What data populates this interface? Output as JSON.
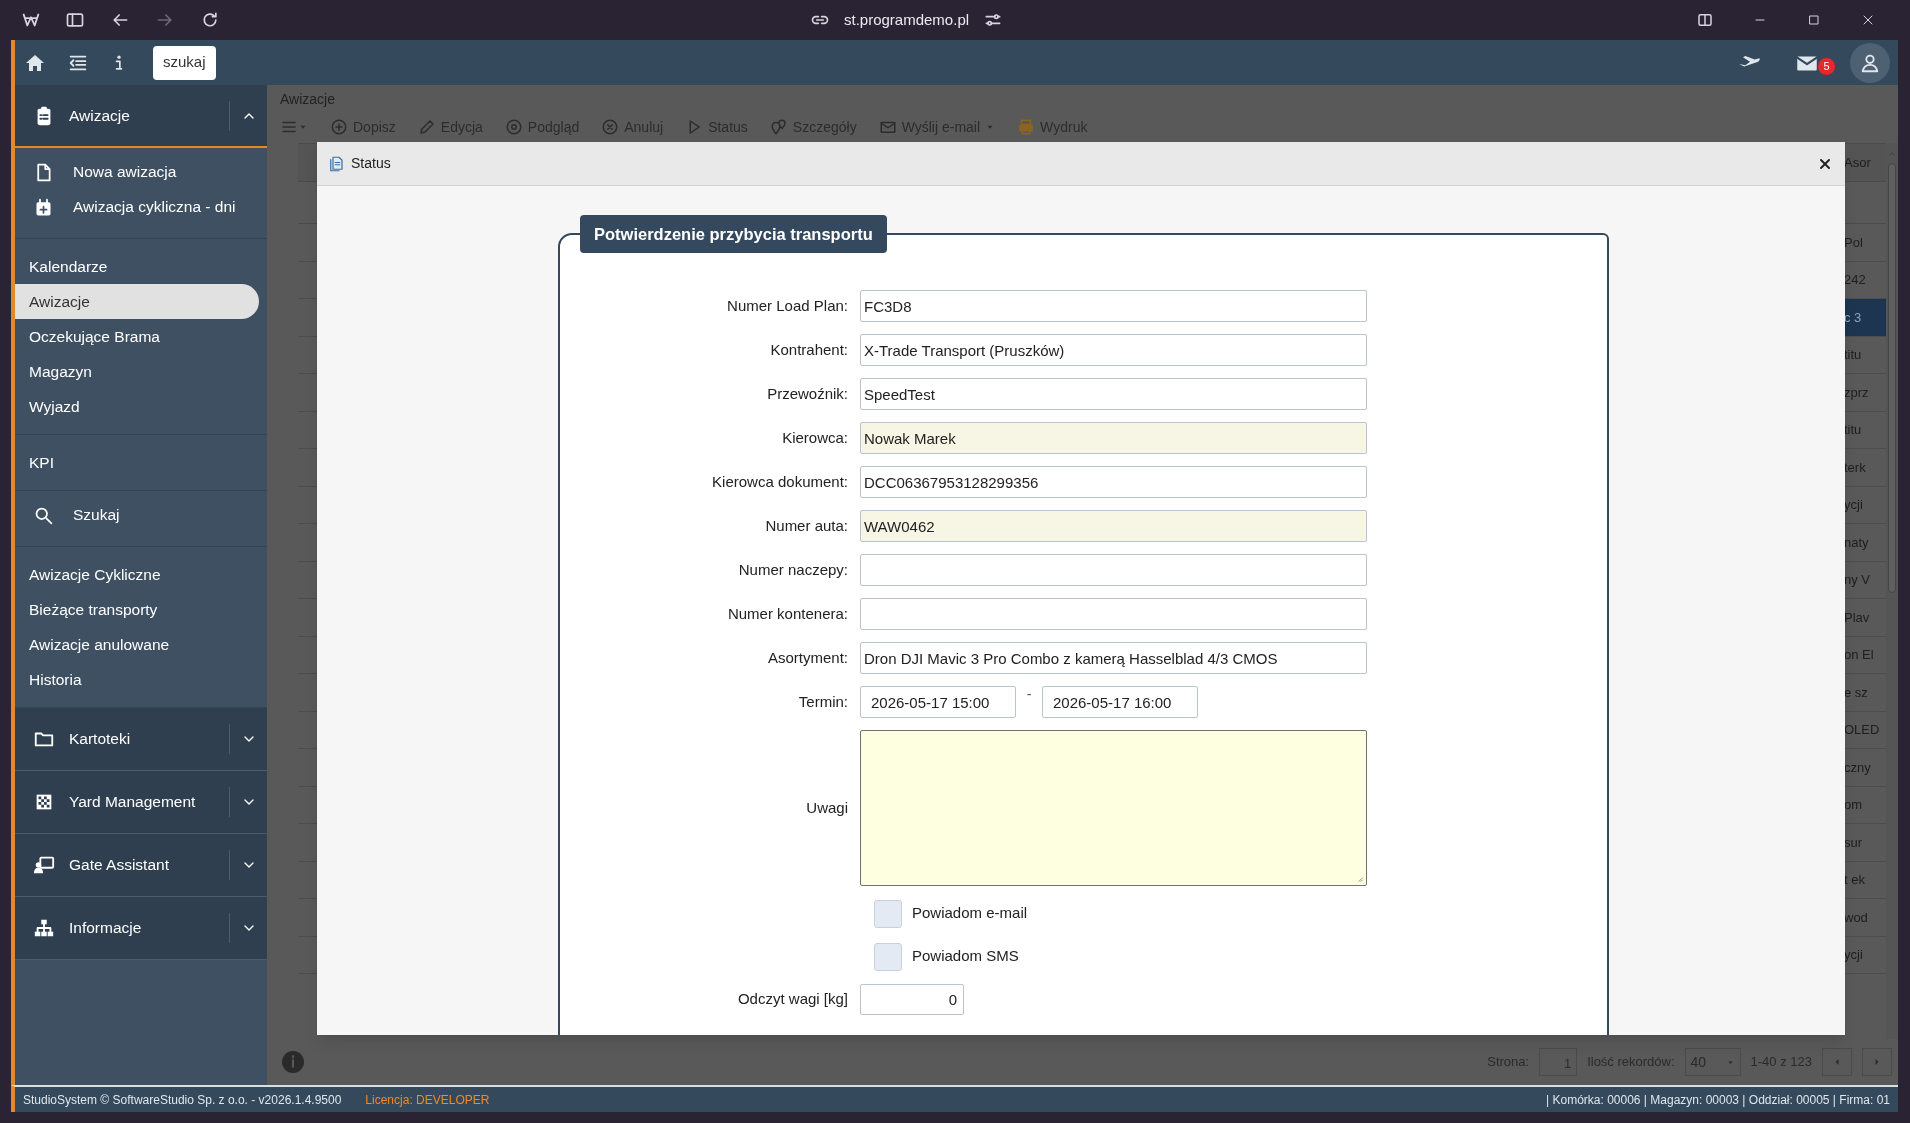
{
  "browser": {
    "url": "st.programdemo.pl"
  },
  "app_bar": {
    "search_button": "szukaj",
    "mail_badge": "5"
  },
  "sidebar": {
    "sections": [
      {
        "kind": "group",
        "label": "Awizacje",
        "expanded": true
      },
      {
        "kind": "list",
        "items": [
          {
            "kind": "icon_item",
            "label": "Nowa awizacja",
            "selected": false
          },
          {
            "kind": "icon_item",
            "label": "Awizacja cykliczna - dni",
            "selected": false
          }
        ]
      },
      {
        "kind": "list",
        "items": [
          {
            "kind": "text_item",
            "label": "Kalendarze",
            "selected": false
          },
          {
            "kind": "text_item",
            "label": "Awizacje",
            "selected": true
          },
          {
            "kind": "text_item",
            "label": "Oczekujące Brama",
            "selected": false
          },
          {
            "kind": "text_item",
            "label": "Magazyn",
            "selected": false
          },
          {
            "kind": "text_item",
            "label": "Wyjazd",
            "selected": false
          }
        ]
      },
      {
        "kind": "list",
        "items": [
          {
            "kind": "text_item",
            "label": "KPI",
            "selected": false
          }
        ]
      },
      {
        "kind": "list",
        "items": [
          {
            "kind": "icon_item",
            "label": "Szukaj",
            "selected": false
          }
        ]
      },
      {
        "kind": "list",
        "items": [
          {
            "kind": "text_item",
            "label": "Awizacje Cykliczne",
            "selected": false
          },
          {
            "kind": "text_item",
            "label": "Bieżące transporty",
            "selected": false
          },
          {
            "kind": "text_item",
            "label": "Awizacje anulowane",
            "selected": false
          },
          {
            "kind": "text_item",
            "label": "Historia",
            "selected": false
          }
        ]
      },
      {
        "kind": "group",
        "label": "Kartoteki",
        "expanded": false
      },
      {
        "kind": "group",
        "label": "Yard Management",
        "expanded": false
      },
      {
        "kind": "group",
        "label": "Gate Assistant",
        "expanded": false
      },
      {
        "kind": "group",
        "label": "Informacje",
        "expanded": false
      }
    ]
  },
  "content": {
    "breadcrumb": "Awizacje",
    "toolbar": [
      {
        "label": "Dopisz",
        "dropdown": false
      },
      {
        "label": "Edycja",
        "dropdown": false
      },
      {
        "label": "Podgląd",
        "dropdown": false
      },
      {
        "label": "Anuluj",
        "dropdown": false
      },
      {
        "label": "Status",
        "dropdown": false
      },
      {
        "label": "Szczegóły",
        "dropdown": false
      },
      {
        "label": "Wyślij e-mail",
        "dropdown": true
      },
      {
        "label": "Wydruk",
        "dropdown": false
      }
    ],
    "table": {
      "column_header": "Asor",
      "cells": [
        {
          "text": "Pol",
          "selected": false
        },
        {
          "text": "242",
          "selected": false
        },
        {
          "text": "c 3",
          "selected": true
        },
        {
          "text": "titu",
          "selected": false
        },
        {
          "text": "zprz",
          "selected": false
        },
        {
          "text": "titu",
          "selected": false
        },
        {
          "text": "terk",
          "selected": false
        },
        {
          "text": "ycji",
          "selected": false
        },
        {
          "text": "naty",
          "selected": false
        },
        {
          "text": "ny V",
          "selected": false
        },
        {
          "text": "Plav",
          "selected": false
        },
        {
          "text": "on El",
          "selected": false
        },
        {
          "text": "e sz",
          "selected": false
        },
        {
          "text": "OLED",
          "selected": false
        },
        {
          "text": "czny",
          "selected": false
        },
        {
          "text": "om",
          "selected": false
        },
        {
          "text": "sur",
          "selected": false
        },
        {
          "text": "t ek",
          "selected": false
        },
        {
          "text": "wod",
          "selected": false
        },
        {
          "text": "ycji",
          "selected": false
        }
      ]
    },
    "pager": {
      "page_label": "Strona:",
      "page": "1",
      "rows_label": "Ilość rekordów:",
      "rows": "40",
      "range": "1-40 z 123"
    }
  },
  "modal": {
    "title": "Status",
    "legend": "Potwierdzenie przybycia transportu",
    "fields": [
      {
        "kind": "text",
        "label": "Numer Load Plan:",
        "value": "FC3D8",
        "highlighted": false
      },
      {
        "kind": "text",
        "label": "Kontrahent:",
        "value": "X-Trade Transport (Pruszków)",
        "highlighted": false
      },
      {
        "kind": "text",
        "label": "Przewoźnik:",
        "value": "SpeedTest",
        "highlighted": false
      },
      {
        "kind": "text",
        "label": "Kierowca:",
        "value": "Nowak Marek",
        "highlighted": true
      },
      {
        "kind": "text",
        "label": "Kierowca dokument:",
        "value": "DCC06367953128299356",
        "highlighted": false
      },
      {
        "kind": "text",
        "label": "Numer auta:",
        "value": "WAW0462",
        "highlighted": true
      },
      {
        "kind": "text",
        "label": "Numer naczepy:",
        "highlighted": false
      },
      {
        "kind": "text",
        "label": "Numer kontenera:",
        "highlighted": false
      },
      {
        "kind": "text",
        "label": "Asortyment:",
        "value": "Dron DJI Mavic 3 Pro Combo z kamerą Hasselblad 4/3 CMOS",
        "highlighted": false
      },
      {
        "kind": "range",
        "label": "Termin:",
        "from": "2026-05-17 15:00",
        "separator": "-",
        "to": "2026-05-17 16:00"
      },
      {
        "kind": "textarea",
        "label": "Uwagi"
      },
      {
        "kind": "checkbox",
        "label": "Powiadom e-mail",
        "checked": false
      },
      {
        "kind": "checkbox",
        "label": "Powiadom SMS",
        "checked": false
      },
      {
        "kind": "number",
        "label": "Odczyt wagi [kg]",
        "value": "0"
      }
    ]
  },
  "footer": {
    "copyright": "StudioSystem © SoftwareStudio Sp. z o.o. - v2026.1.4.9500",
    "license": "Licencja: DEVELOPER",
    "status": "| Komórka: 00006 | Magazyn: 00003 | Oddział: 00005 | Firma: 01"
  }
}
